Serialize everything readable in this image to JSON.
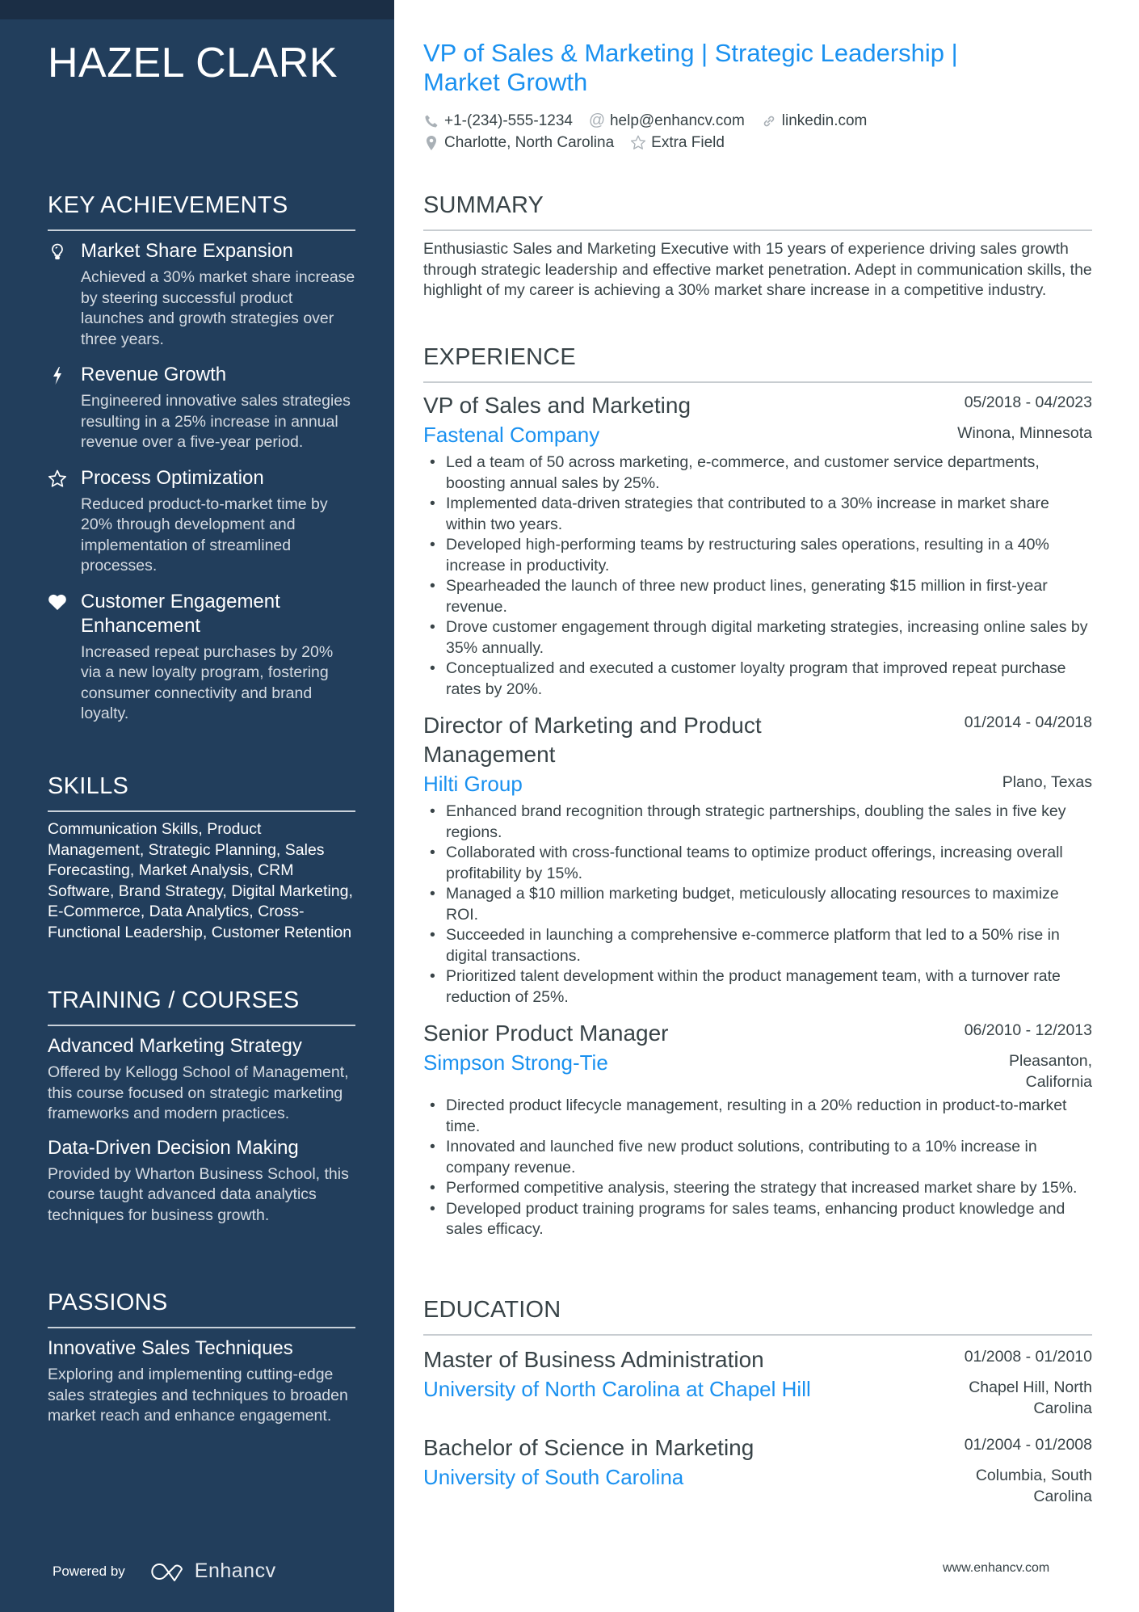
{
  "sidebar": {
    "name": "HAZEL CLARK",
    "achievements": {
      "title": "KEY ACHIEVEMENTS",
      "items": [
        {
          "icon": "lightbulb-icon",
          "title": "Market Share Expansion",
          "desc": "Achieved a 30% market share increase by steering successful product launches and growth strategies over three years."
        },
        {
          "icon": "lightning-icon",
          "title": "Revenue Growth",
          "desc": "Engineered innovative sales strategies resulting in a 25% increase in annual revenue over a five-year period."
        },
        {
          "icon": "star-icon",
          "title": "Process Optimization",
          "desc": "Reduced product-to-market time by 20% through development and implementation of streamlined processes."
        },
        {
          "icon": "heart-icon",
          "title": "Customer Engagement Enhancement",
          "desc": "Increased repeat purchases by 20% via a new loyalty program, fostering consumer connectivity and brand loyalty."
        }
      ]
    },
    "skills": {
      "title": "SKILLS",
      "text": "Communication Skills, Product Management, Strategic Planning, Sales Forecasting, Market Analysis, CRM Software, Brand Strategy, Digital Marketing, E-Commerce, Data Analytics, Cross-Functional Leadership, Customer Retention"
    },
    "training": {
      "title": "TRAINING / COURSES",
      "items": [
        {
          "title": "Advanced Marketing Strategy",
          "desc": "Offered by Kellogg School of Management, this course focused on strategic marketing frameworks and modern practices."
        },
        {
          "title": "Data-Driven Decision Making",
          "desc": "Provided by Wharton Business School, this course taught advanced data analytics techniques for business growth."
        }
      ]
    },
    "passions": {
      "title": "PASSIONS",
      "items": [
        {
          "title": "Innovative Sales Techniques",
          "desc": "Exploring and implementing cutting-edge sales strategies and techniques to broaden market reach and enhance engagement."
        }
      ]
    },
    "powered_by": "Powered by",
    "brand": "Enhancv"
  },
  "header": {
    "headline": "VP of Sales & Marketing | Strategic Leadership | Market Growth",
    "contacts": {
      "phone": "+1-(234)-555-1234",
      "email": "help@enhancv.com",
      "link": "linkedin.com",
      "location": "Charlotte, North Carolina",
      "extra": "Extra Field"
    }
  },
  "summary": {
    "title": "SUMMARY",
    "text": "Enthusiastic Sales and Marketing Executive with 15 years of experience driving sales growth through strategic leadership and effective market penetration. Adept in communication skills, the highlight of my career is achieving a 30% market share increase in a competitive industry."
  },
  "experience": {
    "title": "EXPERIENCE",
    "jobs": [
      {
        "title": "VP of Sales and Marketing",
        "dates": "05/2018 - 04/2023",
        "company": "Fastenal Company",
        "location": "Winona, Minnesota",
        "bullets": [
          "Led a team of 50 across marketing, e-commerce, and customer service departments, boosting annual sales by 25%.",
          "Implemented data-driven strategies that contributed to a 30% increase in market share within two years.",
          "Developed high-performing teams by restructuring sales operations, resulting in a 40% increase in productivity.",
          "Spearheaded the launch of three new product lines, generating $15 million in first-year revenue.",
          "Drove customer engagement through digital marketing strategies, increasing online sales by 35% annually.",
          "Conceptualized and executed a customer loyalty program that improved repeat purchase rates by 20%."
        ]
      },
      {
        "title": "Director of Marketing and Product Management",
        "dates": "01/2014 - 04/2018",
        "company": "Hilti Group",
        "location": "Plano, Texas",
        "bullets": [
          "Enhanced brand recognition through strategic partnerships, doubling the sales in five key regions.",
          "Collaborated with cross-functional teams to optimize product offerings, increasing overall profitability by 15%.",
          "Managed a $10 million marketing budget, meticulously allocating resources to maximize ROI.",
          "Succeeded in launching a comprehensive e-commerce platform that led to a 50% rise in digital transactions.",
          "Prioritized talent development within the product management team, with a turnover rate reduction of 25%."
        ]
      },
      {
        "title": "Senior Product Manager",
        "dates": "06/2010 - 12/2013",
        "company": "Simpson Strong-Tie",
        "location": "Pleasanton, California",
        "bullets": [
          "Directed product lifecycle management, resulting in a 20% reduction in product-to-market time.",
          "Innovated and launched five new product solutions, contributing to a 10% increase in company revenue.",
          "Performed competitive analysis, steering the strategy that increased market share by 15%.",
          "Developed product training programs for sales teams, enhancing product knowledge and sales efficacy."
        ]
      }
    ]
  },
  "education": {
    "title": "EDUCATION",
    "items": [
      {
        "degree": "Master of Business Administration",
        "dates": "01/2008 - 01/2010",
        "school": "University of North Carolina at Chapel Hill",
        "location": "Chapel Hill, North Carolina"
      },
      {
        "degree": "Bachelor of Science in Marketing",
        "dates": "01/2004 - 01/2008",
        "school": "University of South Carolina",
        "location": "Columbia, South Carolina"
      }
    ]
  },
  "footer": {
    "url": "www.enhancv.com"
  },
  "colors": {
    "sidebar": "#223e5c",
    "accent": "#1a91f0",
    "text": "#384347"
  }
}
